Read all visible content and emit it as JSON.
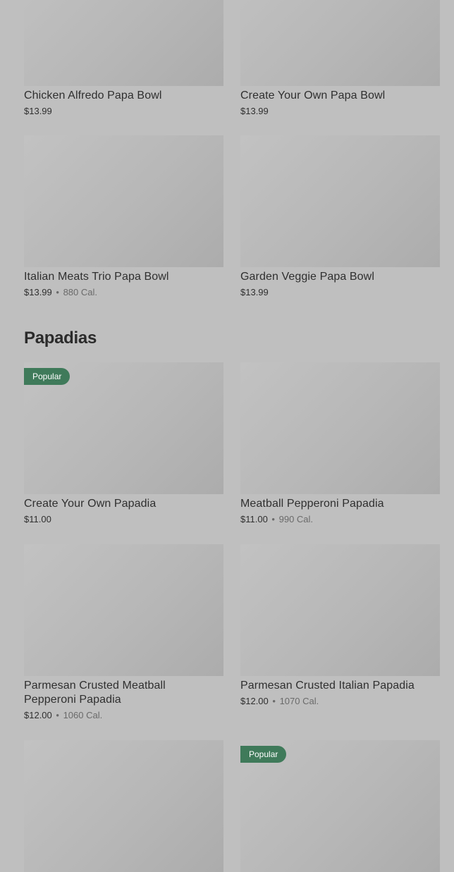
{
  "sections": {
    "papadias_title": "Papadias"
  },
  "items": {
    "chicken_alfredo_bowl": {
      "name": "Chicken Alfredo Papa Bowl",
      "price": "$13.99"
    },
    "create_own_bowl": {
      "name": "Create Your Own Papa Bowl",
      "price": "$13.99"
    },
    "italian_meats_bowl": {
      "name": "Italian Meats Trio Papa Bowl",
      "price": "$13.99",
      "separator": "•",
      "calories": "880 Cal."
    },
    "garden_veggie_bowl": {
      "name": "Garden Veggie Papa Bowl",
      "price": "$13.99"
    },
    "create_own_papadia": {
      "name": "Create Your Own Papadia",
      "price": "$11.00",
      "badge": "Popular"
    },
    "meatball_pepperoni_papadia": {
      "name": "Meatball Pepperoni Papadia",
      "price": "$11.00",
      "separator": "•",
      "calories": "990 Cal."
    },
    "parmesan_meatball_papadia": {
      "name_line1": "Parmesan Crusted Meatball",
      "name_line2": "Pepperoni Papadia",
      "price": "$12.00",
      "separator": "•",
      "calories": "1060 Cal."
    },
    "parmesan_italian_papadia": {
      "name": "Parmesan Crusted Italian Papadia",
      "price": "$12.00",
      "separator": "•",
      "calories": "1070 Cal."
    },
    "bottom_right_item": {
      "badge": "Popular"
    }
  },
  "colors": {
    "overlay_background": "#bfbfbf",
    "badge_green": "#3f7a5a"
  }
}
